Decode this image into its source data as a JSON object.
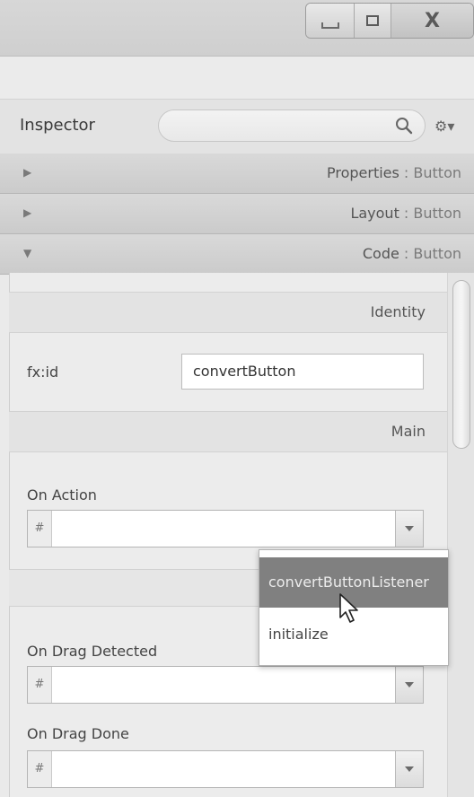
{
  "window": {
    "minimize_icon": "minimize-icon",
    "maximize_icon": "maximize-icon",
    "close_glyph": "X"
  },
  "inspector": {
    "title": "Inspector",
    "search_placeholder": "",
    "settings_glyph": "⚙▾"
  },
  "sections": [
    {
      "label": "Properties",
      "sep": " : ",
      "type": "Button",
      "arrow": "▶"
    },
    {
      "label": "Layout",
      "sep": " : ",
      "type": "Button",
      "arrow": "▶"
    },
    {
      "label": "Code",
      "sep": " : ",
      "type": "Button",
      "arrow": "▼"
    }
  ],
  "code": {
    "identity_header": "Identity",
    "fxid_label": "fx:id",
    "fxid_value": "convertButton",
    "main_header": "Main",
    "on_action_label": "On Action",
    "on_drag_detected_label": "On Drag Detected",
    "on_drag_done_label": "On Drag Done",
    "hash": "#"
  },
  "dropdown": {
    "options": [
      "convertButtonListener",
      "initialize"
    ],
    "selected": "convertButtonListener"
  }
}
